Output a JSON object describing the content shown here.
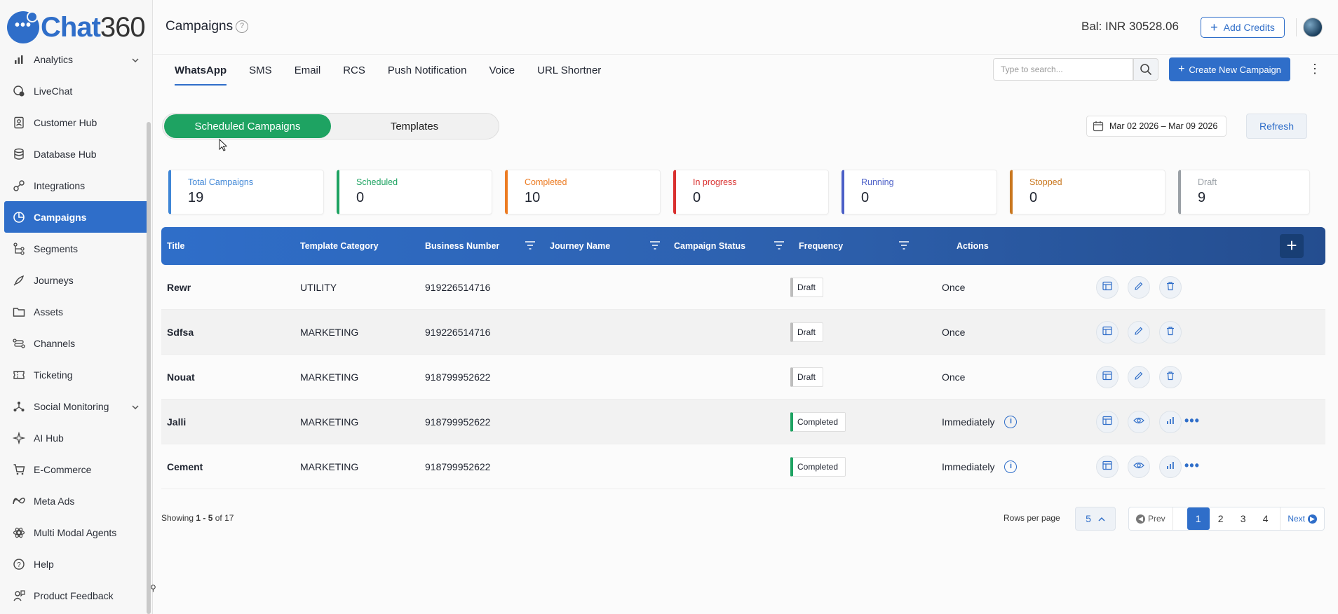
{
  "app": {
    "logo_main": "Chat",
    "logo_num": "360"
  },
  "sidebar": {
    "items": [
      {
        "label": "Analytics",
        "icon": "chart-bar-icon",
        "chevron": "⌄"
      },
      {
        "label": "LiveChat",
        "icon": "livechat-icon"
      },
      {
        "label": "Customer Hub",
        "icon": "contacts-icon"
      },
      {
        "label": "Database Hub",
        "icon": "database-icon"
      },
      {
        "label": "Integrations",
        "icon": "integrations-icon"
      },
      {
        "label": "Campaigns",
        "icon": "pie-chart-icon",
        "active": true
      },
      {
        "label": "Segments",
        "icon": "segments-icon"
      },
      {
        "label": "Journeys",
        "icon": "rocket-icon"
      },
      {
        "label": "Assets",
        "icon": "folder-icon"
      },
      {
        "label": "Channels",
        "icon": "channels-icon"
      },
      {
        "label": "Ticketing",
        "icon": "ticket-icon"
      },
      {
        "label": "Social Monitoring",
        "icon": "social-icon",
        "chevron": "⌄"
      },
      {
        "label": "AI Hub",
        "icon": "sparkle-icon"
      },
      {
        "label": "E-Commerce",
        "icon": "cart-icon"
      },
      {
        "label": "Meta Ads",
        "icon": "meta-icon"
      },
      {
        "label": "Multi Modal Agents",
        "icon": "agents-icon"
      },
      {
        "label": "Help",
        "icon": "help-icon"
      },
      {
        "label": "Product Feedback",
        "icon": "feedback-icon"
      }
    ]
  },
  "header": {
    "title": "Campaigns",
    "help_glyph": "?",
    "balance": "Bal: INR 30528.06",
    "add_credits": "Add Credits",
    "add_credits_glyph": "+"
  },
  "channel_tabs": [
    "WhatsApp",
    "SMS",
    "Email",
    "RCS",
    "Push Notification",
    "Voice",
    "URL Shortner"
  ],
  "search": {
    "placeholder": "Type to search..."
  },
  "create_button": {
    "label": "Create New Campaign",
    "glyph": "+"
  },
  "kebab_glyph": "⋮",
  "toggle": {
    "active": "Scheduled Campaigns",
    "inactive": "Templates"
  },
  "date_range": "Mar 02 2026 – Mar 09 2026",
  "refresh": "Refresh",
  "stats": [
    {
      "label": "Total Campaigns",
      "value": "19",
      "color": "#3f86d6"
    },
    {
      "label": "Scheduled",
      "value": "0",
      "color": "#1ea362"
    },
    {
      "label": "Completed",
      "value": "10",
      "color": "#ec7b22"
    },
    {
      "label": "In progress",
      "value": "0",
      "color": "#d9302f"
    },
    {
      "label": "Running",
      "value": "0",
      "color": "#4b5fc7"
    },
    {
      "label": "Stopped",
      "value": "0",
      "color": "#c9771f"
    },
    {
      "label": "Draft",
      "value": "9",
      "color": "#9aa0a6"
    }
  ],
  "table": {
    "columns": [
      "Title",
      "Template Category",
      "Business Number",
      "Journey Name",
      "Campaign Status",
      "Frequency",
      "Actions"
    ],
    "add_glyph": "+",
    "info_glyph": "i",
    "more_glyph": "•••",
    "rows": [
      {
        "title": "Rewr",
        "category": "UTILITY",
        "number": "919226514716",
        "journey": "",
        "status": "Draft",
        "frequency": "Once"
      },
      {
        "title": "Sdfsa",
        "category": "MARKETING",
        "number": "919226514716",
        "journey": "",
        "status": "Draft",
        "frequency": "Once"
      },
      {
        "title": "Nouat",
        "category": "MARKETING",
        "number": "918799952622",
        "journey": "",
        "status": "Draft",
        "frequency": "Once"
      },
      {
        "title": "Jalli",
        "category": "MARKETING",
        "number": "918799952622",
        "journey": "",
        "status": "Completed",
        "frequency": "Immediately"
      },
      {
        "title": "Cement",
        "category": "MARKETING",
        "number": "918799952622",
        "journey": "",
        "status": "Completed",
        "frequency": "Immediately"
      }
    ]
  },
  "footer": {
    "showing_prefix": "Showing",
    "showing_range": "1 - 5",
    "showing_of": "of 17",
    "rows_per_page_label": "Rows per page",
    "rows_per_page": "5",
    "prev": "Prev",
    "next": "Next",
    "pages": [
      "1",
      "2",
      "3",
      "4"
    ],
    "current_page": "1"
  },
  "colors": {
    "primary": "#2f6ec9",
    "success": "#1ea362"
  }
}
